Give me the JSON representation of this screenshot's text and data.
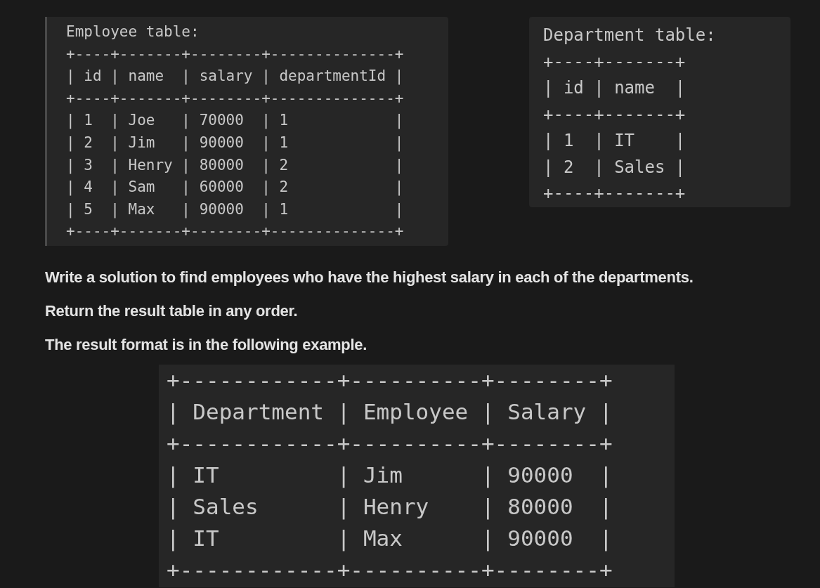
{
  "employee_block": {
    "title": "Employee table:",
    "lines": [
      "+----+-------+--------+--------------+",
      "| id | name  | salary | departmentId |",
      "+----+-------+--------+--------------+",
      "| 1  | Joe   | 70000  | 1            |",
      "| 2  | Jim   | 90000  | 1            |",
      "| 3  | Henry | 80000  | 2            |",
      "| 4  | Sam   | 60000  | 2            |",
      "| 5  | Max   | 90000  | 1            |",
      "+----+-------+--------+--------------+"
    ]
  },
  "department_block": {
    "title": "Department table:",
    "lines": [
      "+----+-------+",
      "| id | name  |",
      "+----+-------+",
      "| 1  | IT    |",
      "| 2  | Sales |",
      "+----+-------+"
    ]
  },
  "paragraphs": [
    "Write a solution to find employees who have the highest salary in each of the departments.",
    "Return the result table in any order.",
    "The result format is in the following example."
  ],
  "result_block": {
    "lines": [
      "+------------+----------+--------+",
      "| Department | Employee | Salary |",
      "+------------+----------+--------+",
      "| IT         | Jim      | 90000  |",
      "| Sales      | Henry    | 80000  |",
      "| IT         | Max      | 90000  |",
      "+------------+----------+--------+"
    ]
  }
}
